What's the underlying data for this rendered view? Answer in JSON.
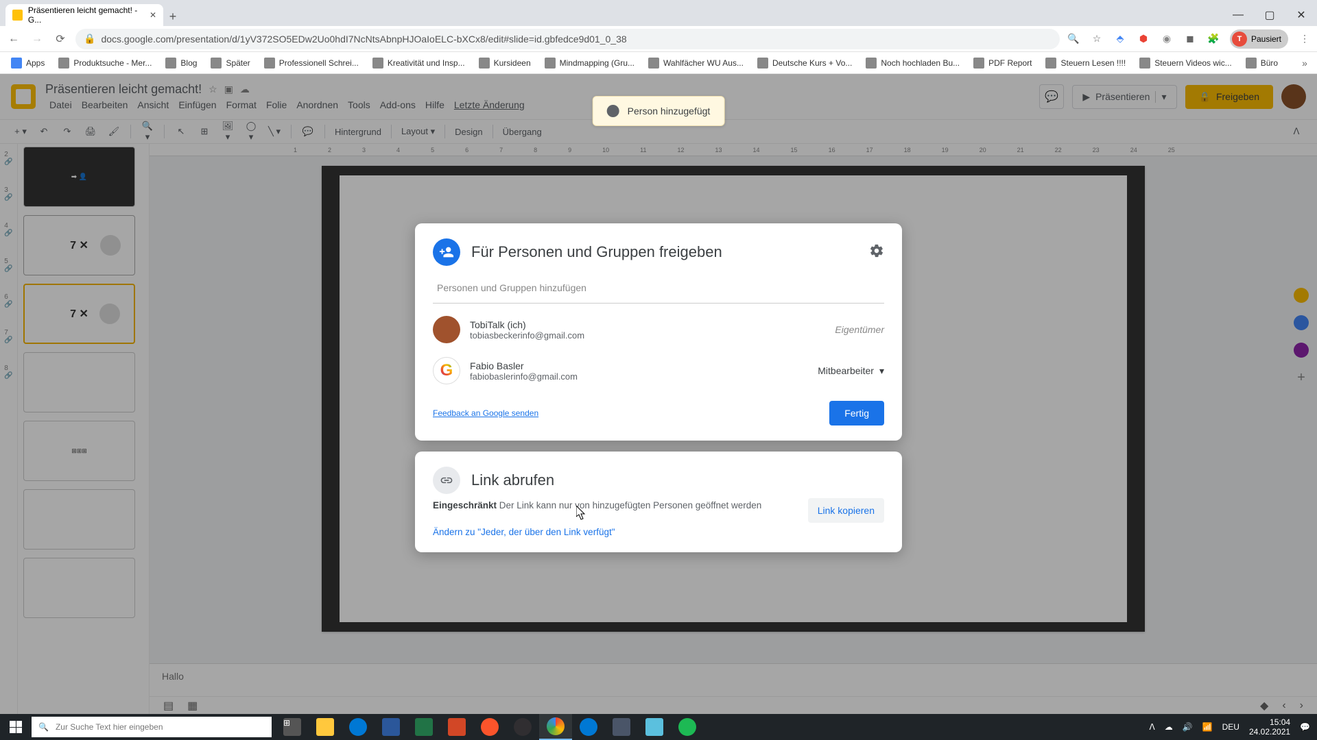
{
  "browser": {
    "tab_title": "Präsentieren leicht gemacht! - G...",
    "url": "docs.google.com/presentation/d/1yV372SO5EDw2Uo0hdI7NcNtsAbnpHJOaIoELC-bXCx8/edit#slide=id.gbfedce9d01_0_38",
    "profile_status": "Pausiert",
    "profile_initial": "T"
  },
  "bookmarks": {
    "apps": "Apps",
    "items": [
      "Produktsuche - Mer...",
      "Blog",
      "Später",
      "Professionell Schrei...",
      "Kreativität und Insp...",
      "Kursideen",
      "Mindmapping  (Gru...",
      "Wahlfächer WU Aus...",
      "Deutsche Kurs + Vo...",
      "Noch hochladen Bu...",
      "PDF Report",
      "Steuern Lesen !!!!",
      "Steuern Videos wic...",
      "Büro"
    ]
  },
  "app": {
    "doc_title": "Präsentieren leicht gemacht!",
    "menus": [
      "Datei",
      "Bearbeiten",
      "Ansicht",
      "Einfügen",
      "Format",
      "Folie",
      "Anordnen",
      "Tools",
      "Add-ons",
      "Hilfe",
      "Letzte Änderung"
    ],
    "present": "Präsentieren",
    "share": "Freigeben",
    "toolbar": {
      "background": "Hintergrund",
      "layout": "Layout",
      "design": "Design",
      "transition": "Übergang"
    },
    "notes": "Hallo"
  },
  "toast": {
    "text": "Person hinzugefügt"
  },
  "share_dialog": {
    "title": "Für Personen und Gruppen freigeben",
    "input_placeholder": "Personen und Gruppen hinzufügen",
    "people": [
      {
        "name": "TobiTalk (ich)",
        "email": "tobiasbeckerinfo@gmail.com",
        "role": "Eigentümer"
      },
      {
        "name": "Fabio Basler",
        "email": "fabiobaslerinfo@gmail.com",
        "role": "Mitbearbeiter"
      }
    ],
    "feedback": "Feedback an Google senden",
    "done": "Fertig",
    "link_title": "Link abrufen",
    "restricted": "Eingeschränkt",
    "link_desc": " Der Link kann nur von hinzugefügten Personen geöffnet werden",
    "copy_link": "Link kopieren",
    "change_link": "Ändern zu \"Jeder, der über den Link verfügt\""
  },
  "taskbar": {
    "search": "Zur Suche Text hier eingeben",
    "time": "15:04",
    "date": "24.02.2021",
    "lang": "DEU"
  },
  "ruler": [
    "1",
    "2",
    "3",
    "4",
    "5",
    "6",
    "7",
    "8",
    "9",
    "10",
    "11",
    "12",
    "13",
    "14",
    "15",
    "16",
    "17",
    "18",
    "19",
    "20",
    "21",
    "22",
    "23",
    "24",
    "25"
  ]
}
